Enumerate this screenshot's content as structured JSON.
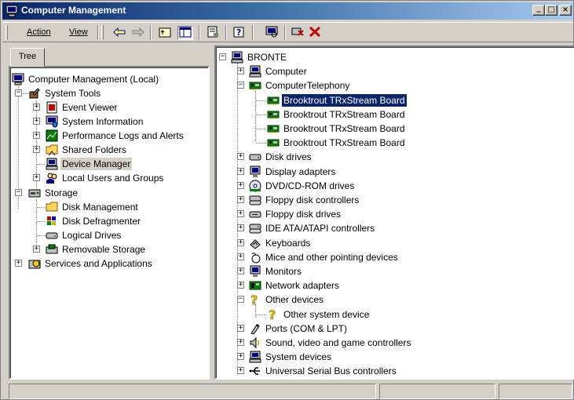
{
  "window": {
    "title": "Computer Management",
    "icon": "computer-management-icon",
    "controls": {
      "minimize": "_",
      "maximize": "□",
      "close": "×"
    }
  },
  "menu": {
    "action": "Action",
    "view": "View"
  },
  "toolbar": {
    "icons": [
      "back-arrow-icon",
      "forward-arrow-icon",
      "up-folder-icon",
      "show-hide-tree-icon",
      "properties-icon",
      "help-icon",
      "scan-hardware-icon",
      "uninstall-icon",
      "disable-icon"
    ]
  },
  "left_pane": {
    "tab_label": "Tree",
    "items": [
      {
        "label": "Computer Management (Local)",
        "icon": "computer-management-icon"
      },
      {
        "label": "System Tools",
        "icon": "system-tools-icon"
      },
      {
        "label": "Event Viewer",
        "icon": "event-viewer-icon"
      },
      {
        "label": "System Information",
        "icon": "system-information-icon"
      },
      {
        "label": "Performance Logs and Alerts",
        "icon": "performance-logs-icon"
      },
      {
        "label": "Shared Folders",
        "icon": "shared-folders-icon"
      },
      {
        "label": "Device Manager",
        "icon": "device-manager-icon"
      },
      {
        "label": "Local Users and Groups",
        "icon": "local-users-icon"
      },
      {
        "label": "Storage",
        "icon": "storage-icon"
      },
      {
        "label": "Disk Management",
        "icon": "disk-management-icon"
      },
      {
        "label": "Disk Defragmenter",
        "icon": "disk-defragmenter-icon"
      },
      {
        "label": "Logical Drives",
        "icon": "logical-drives-icon"
      },
      {
        "label": "Removable Storage",
        "icon": "removable-storage-icon"
      },
      {
        "label": "Services and Applications",
        "icon": "services-applications-icon"
      }
    ]
  },
  "right_pane": {
    "items": [
      {
        "label": "BRONTE",
        "icon": "computer-icon"
      },
      {
        "label": "Computer",
        "icon": "computer-icon"
      },
      {
        "label": "ComputerTelephony",
        "icon": "board-icon"
      },
      {
        "label": "Brooktrout TRxStream Board",
        "icon": "board-icon"
      },
      {
        "label": "Brooktrout TRxStream Board",
        "icon": "board-icon"
      },
      {
        "label": "Brooktrout TRxStream Board",
        "icon": "board-icon"
      },
      {
        "label": "Brooktrout TRxStream Board",
        "icon": "board-icon"
      },
      {
        "label": "Disk drives",
        "icon": "disk-drive-icon"
      },
      {
        "label": "Display adapters",
        "icon": "display-adapter-icon"
      },
      {
        "label": "DVD/CD-ROM drives",
        "icon": "cdrom-icon"
      },
      {
        "label": "Floppy disk controllers",
        "icon": "floppy-controller-icon"
      },
      {
        "label": "Floppy disk drives",
        "icon": "floppy-drive-icon"
      },
      {
        "label": "IDE ATA/ATAPI controllers",
        "icon": "ide-controller-icon"
      },
      {
        "label": "Keyboards",
        "icon": "keyboard-icon"
      },
      {
        "label": "Mice and other pointing devices",
        "icon": "mouse-icon"
      },
      {
        "label": "Monitors",
        "icon": "monitor-icon"
      },
      {
        "label": "Network adapters",
        "icon": "network-adapter-icon"
      },
      {
        "label": "Other devices",
        "icon": "question-mark-icon"
      },
      {
        "label": "Other system device",
        "icon": "question-mark-icon"
      },
      {
        "label": "Ports (COM & LPT)",
        "icon": "port-icon"
      },
      {
        "label": "Sound, video and game controllers",
        "icon": "sound-icon"
      },
      {
        "label": "System devices",
        "icon": "system-device-icon"
      },
      {
        "label": "Universal Serial Bus controllers",
        "icon": "usb-icon"
      }
    ]
  },
  "colors": {
    "title_gradient_start": "#0a246a",
    "title_gradient_end": "#a6caf0",
    "selection": "#0a246a",
    "face": "#d4d0c8"
  }
}
